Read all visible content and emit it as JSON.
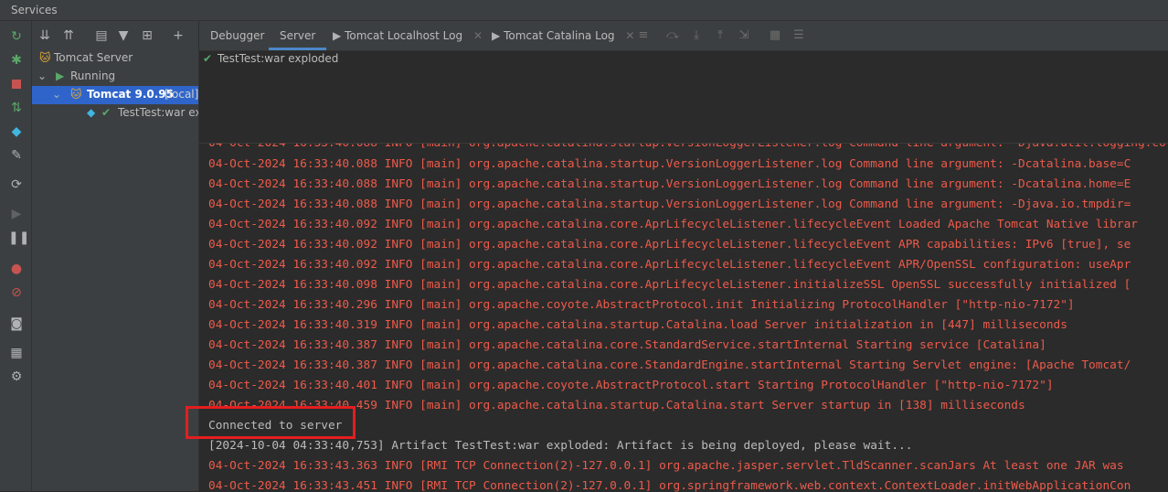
{
  "window": {
    "title": "Services"
  },
  "tree_toolbar": {
    "icons": [
      "expand-all-icon",
      "collapse-all-icon",
      "group-by-icon",
      "filter-icon",
      "new-tab-icon",
      "add-icon"
    ]
  },
  "left_toolbar": {
    "icons": [
      "rerun-icon",
      "update-app-icon",
      "stop-icon",
      "deploy-icon",
      "artifact-icon",
      "settings-wrench-icon",
      "refresh-icon",
      "resume-icon",
      "pause-icon",
      "breakpoints-icon",
      "mute-breakpoints-icon",
      "camera-icon",
      "layout-icon",
      "gear-icon"
    ]
  },
  "tree": {
    "root": "Tomcat Server",
    "running": "Running",
    "server_name": "Tomcat 9.0.95",
    "server_tag": "[local]",
    "artifact": "TestTest:war exp"
  },
  "tabs": [
    {
      "label": "Debugger"
    },
    {
      "label": "Server"
    },
    {
      "label": "Tomcat Localhost Log"
    },
    {
      "label": "Tomcat Catalina Log"
    }
  ],
  "deploy_status": {
    "text": "TestTest:war exploded"
  },
  "console": {
    "partial_top": "04-Oct-2024 16:33:40.088 INFO [main] org.apache.catalina.startup.VersionLoggerListener.log Command line argument: -Djava.util.logging.co",
    "lines": [
      "04-Oct-2024 16:33:40.088 INFO [main] org.apache.catalina.startup.VersionLoggerListener.log Command line argument: -Dcatalina.base=C",
      "04-Oct-2024 16:33:40.088 INFO [main] org.apache.catalina.startup.VersionLoggerListener.log Command line argument: -Dcatalina.home=E",
      "04-Oct-2024 16:33:40.088 INFO [main] org.apache.catalina.startup.VersionLoggerListener.log Command line argument: -Djava.io.tmpdir=",
      "04-Oct-2024 16:33:40.092 INFO [main] org.apache.catalina.core.AprLifecycleListener.lifecycleEvent Loaded Apache Tomcat Native librar",
      "04-Oct-2024 16:33:40.092 INFO [main] org.apache.catalina.core.AprLifecycleListener.lifecycleEvent APR capabilities: IPv6 [true], se",
      "04-Oct-2024 16:33:40.092 INFO [main] org.apache.catalina.core.AprLifecycleListener.lifecycleEvent APR/OpenSSL configuration: useApr",
      "04-Oct-2024 16:33:40.098 INFO [main] org.apache.catalina.core.AprLifecycleListener.initializeSSL OpenSSL successfully initialized [",
      "04-Oct-2024 16:33:40.296 INFO [main] org.apache.coyote.AbstractProtocol.init Initializing ProtocolHandler [\"http-nio-7172\"]",
      "04-Oct-2024 16:33:40.319 INFO [main] org.apache.catalina.startup.Catalina.load Server initialization in [447] milliseconds",
      "04-Oct-2024 16:33:40.387 INFO [main] org.apache.catalina.core.StandardService.startInternal Starting service [Catalina]",
      "04-Oct-2024 16:33:40.387 INFO [main] org.apache.catalina.core.StandardEngine.startInternal Starting Servlet engine: [Apache Tomcat/",
      "04-Oct-2024 16:33:40.401 INFO [main] org.apache.coyote.AbstractProtocol.start Starting ProtocolHandler [\"http-nio-7172\"]",
      "04-Oct-2024 16:33:40.459 INFO [main] org.apache.catalina.startup.Catalina.start Server startup in [138] milliseconds"
    ],
    "connected": "Connected to server",
    "artifact_line": "[2024-10-04 04:33:40,753] Artifact TestTest:war exploded: Artifact is being deployed, please wait...",
    "after_lines": [
      "04-Oct-2024 16:33:43.363 INFO [RMI TCP Connection(2)-127.0.0.1] org.apache.jasper.servlet.TldScanner.scanJars At least one JAR was",
      "04-Oct-2024 16:33:43.451 INFO [RMI TCP Connection(2)-127.0.0.1] org.springframework.web.context.ContextLoader.initWebApplicationCon"
    ]
  },
  "colors": {
    "log_red": "#ee5a4a",
    "highlight": "#e41e1e",
    "selection": "#2f65ca",
    "check_green": "#59a869"
  }
}
